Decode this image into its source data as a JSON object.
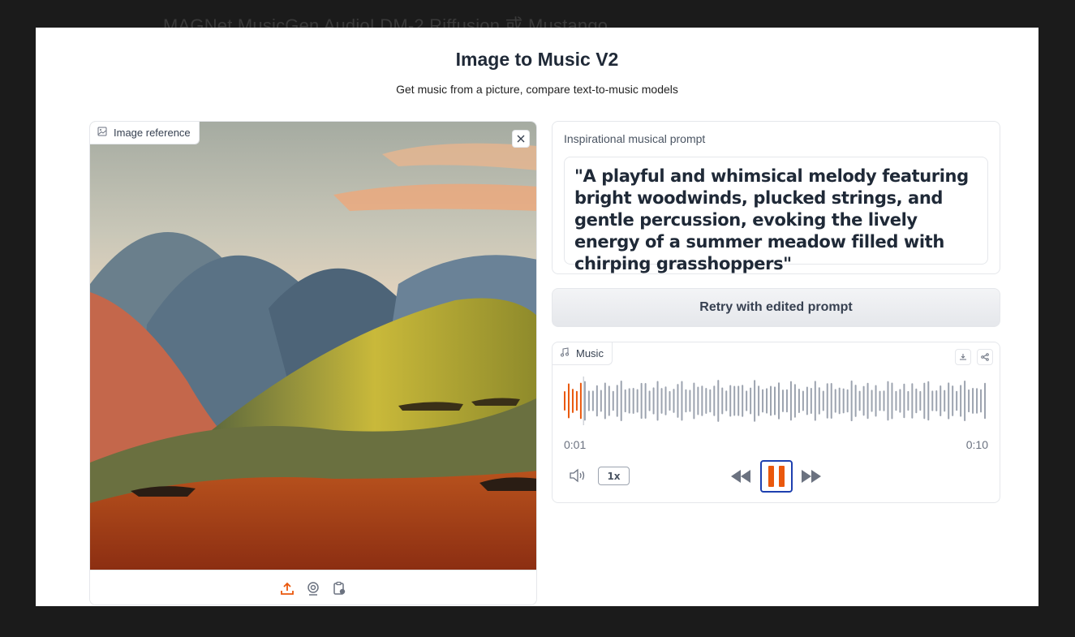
{
  "background": {
    "text": "MAGNet   MusicGen   AudioLDM-2   Riffusion 或 Mustango"
  },
  "header": {
    "title": "Image to Music V2",
    "subtitle": "Get music from a picture, compare text-to-music models"
  },
  "image_panel": {
    "label": "Image reference",
    "toolbar": [
      "upload-icon",
      "webcam-icon",
      "clipboard-icon"
    ]
  },
  "prompt_panel": {
    "label": "Inspirational musical prompt",
    "value": "\"A playful and whimsical melody featuring bright woodwinds, plucked strings, and gentle percussion, evoking the lively energy of a summer meadow filled with chirping grasshoppers\""
  },
  "retry_button": {
    "label": "Retry with edited prompt"
  },
  "music_panel": {
    "label": "Music",
    "current_time": "0:01",
    "duration": "0:10",
    "speed": "1x",
    "progress": 0.1
  },
  "colors": {
    "accent": "#ea580c",
    "wave": "#9ca3af",
    "focus": "#1e40af"
  }
}
